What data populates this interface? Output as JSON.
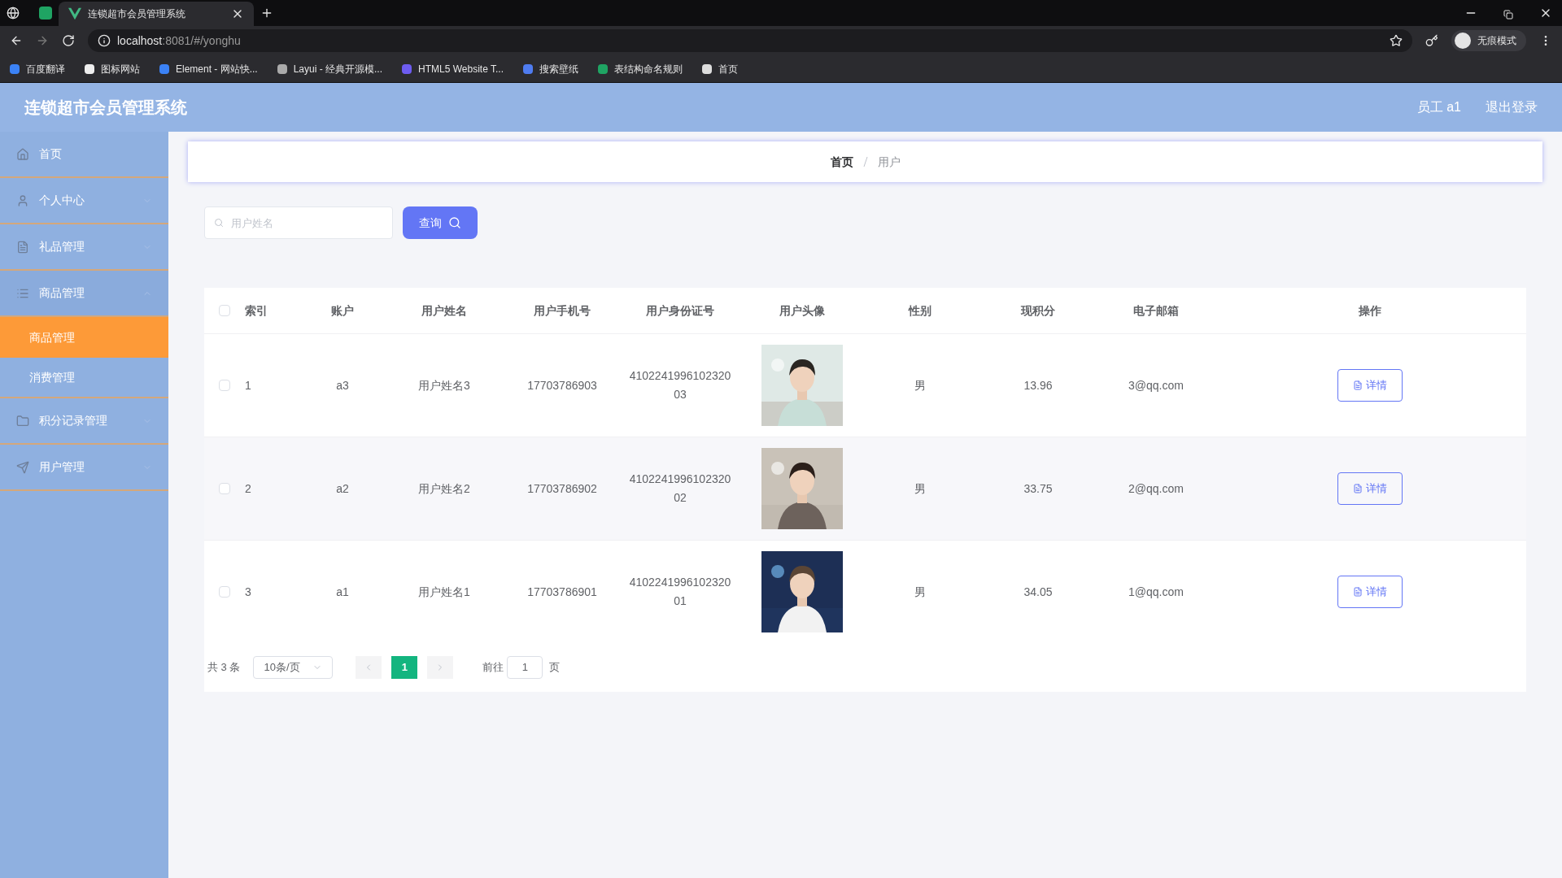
{
  "browser": {
    "tabs": [
      {
        "title": "连锁超市会员管理系统",
        "selected": true
      }
    ],
    "url_host": "localhost",
    "url_rest": ":8081/#/yonghu",
    "profile_label": "无痕模式",
    "bookmarks": [
      "百度翻译",
      "图标网站",
      "Element - 网站快...",
      "Layui - 经典开源模...",
      "HTML5 Website T...",
      "搜索壁纸",
      "表结构命名规则",
      "首页"
    ]
  },
  "header": {
    "title": "连锁超市会员管理系统",
    "user": "员工 a1",
    "logout": "退出登录"
  },
  "sidebar": {
    "items": [
      {
        "label": "首页"
      },
      {
        "label": "个人中心",
        "expanded": false
      },
      {
        "label": "礼品管理",
        "expanded": false
      },
      {
        "label": "商品管理",
        "expanded": true,
        "children": [
          {
            "label": "商品管理",
            "selected": true
          },
          {
            "label": "消费管理",
            "selected": false
          }
        ]
      },
      {
        "label": "积分记录管理",
        "expanded": false
      },
      {
        "label": "用户管理",
        "expanded": false
      }
    ]
  },
  "breadcrumb": [
    "首页",
    "用户"
  ],
  "search": {
    "placeholder": "用户姓名",
    "button": "查询"
  },
  "table": {
    "select_all_checked": false,
    "columns": [
      "索引",
      "账户",
      "用户姓名",
      "用户手机号",
      "用户身份证号",
      "用户头像",
      "性别",
      "现积分",
      "电子邮箱",
      "操作"
    ],
    "rows": [
      {
        "checked": false,
        "index": "1",
        "account": "a3",
        "name": "用户姓名3",
        "phone": "17703786903",
        "id_number": "410224199610232003",
        "gender": "男",
        "points": "13.96",
        "email": "3@qq.com",
        "action": "详情"
      },
      {
        "checked": false,
        "index": "2",
        "account": "a2",
        "name": "用户姓名2",
        "phone": "17703786902",
        "id_number": "410224199610232002",
        "gender": "男",
        "points": "33.75",
        "email": "2@qq.com",
        "action": "详情"
      },
      {
        "checked": false,
        "index": "3",
        "account": "a1",
        "name": "用户姓名1",
        "phone": "17703786901",
        "id_number": "410224199610232001",
        "gender": "男",
        "points": "34.05",
        "email": "1@qq.com",
        "action": "详情"
      }
    ]
  },
  "pagination": {
    "total": "共 3 条",
    "page_size": "10条/页",
    "pages": [
      {
        "label": "1",
        "selected": true
      }
    ],
    "goto_label": "前往",
    "goto_value": "1",
    "goto_suffix": "页"
  }
}
